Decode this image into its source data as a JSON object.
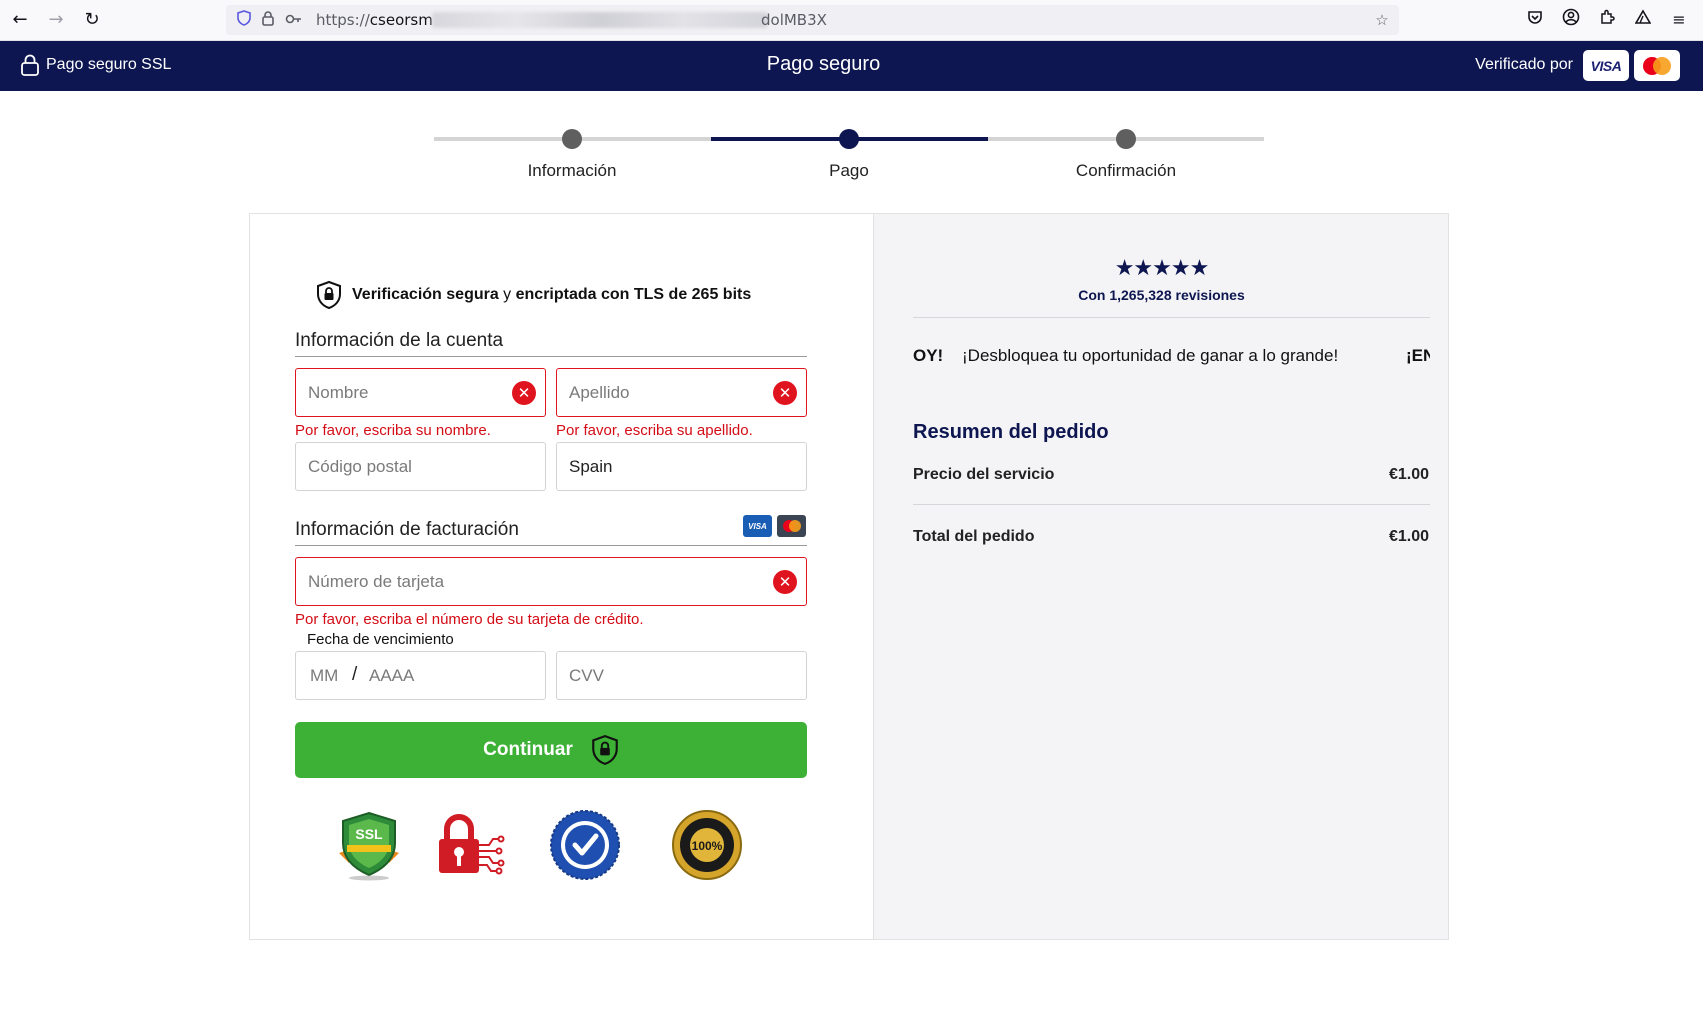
{
  "browser": {
    "url_prefix": "https://",
    "url_host": "cseorsm",
    "url_tail": "dolMB3X"
  },
  "header": {
    "ssl_label": "Pago seguro SSL",
    "title": "Pago seguro",
    "verified_label": "Verificado por",
    "visa_text": "VISA"
  },
  "stepper": {
    "steps": [
      {
        "label": "Información"
      },
      {
        "label": "Pago"
      },
      {
        "label": "Confirmación"
      }
    ],
    "active_step": 2
  },
  "form": {
    "secure_bold1": "Verificación segura",
    "secure_mid": " y ",
    "secure_bold2": "encriptada con TLS de 265 bits",
    "account_title": "Información de la cuenta",
    "first_name_placeholder": "Nombre",
    "last_name_placeholder": "Apellido",
    "first_name_error": "Por favor, escriba su nombre.",
    "last_name_error": "Por favor, escriba su apellido.",
    "postal_placeholder": "Código postal",
    "country_value": "Spain",
    "billing_title": "Información de facturación",
    "mini_visa": "VISA",
    "card_placeholder": "Número de tarjeta",
    "card_error": "Por favor, escriba el número de su tarjeta de crédito.",
    "expiry_label": "Fecha de vencimiento",
    "expiry_month": "MM",
    "expiry_slash": "/",
    "expiry_year": "AAAA",
    "cvv_placeholder": "CVV",
    "continue_label": "Continuar"
  },
  "badges": {
    "ssl_text": "SSL",
    "satisfaction_text": "100%"
  },
  "summary": {
    "stars": "★★★★★",
    "reviews": "Con 1,265,328 revisiones",
    "marquee_left": "OY!",
    "marquee_main": "¡Desbloquea tu oportunidad de ganar a lo grande!",
    "marquee_right": "¡EN",
    "title": "Resumen del pedido",
    "service_label": "Precio del servicio",
    "service_value": "€1.00",
    "total_label": "Total del pedido",
    "total_value": "€1.00"
  },
  "colors": {
    "navy": "#0d1650",
    "error": "#e0141f",
    "continue_green": "#3db036"
  }
}
